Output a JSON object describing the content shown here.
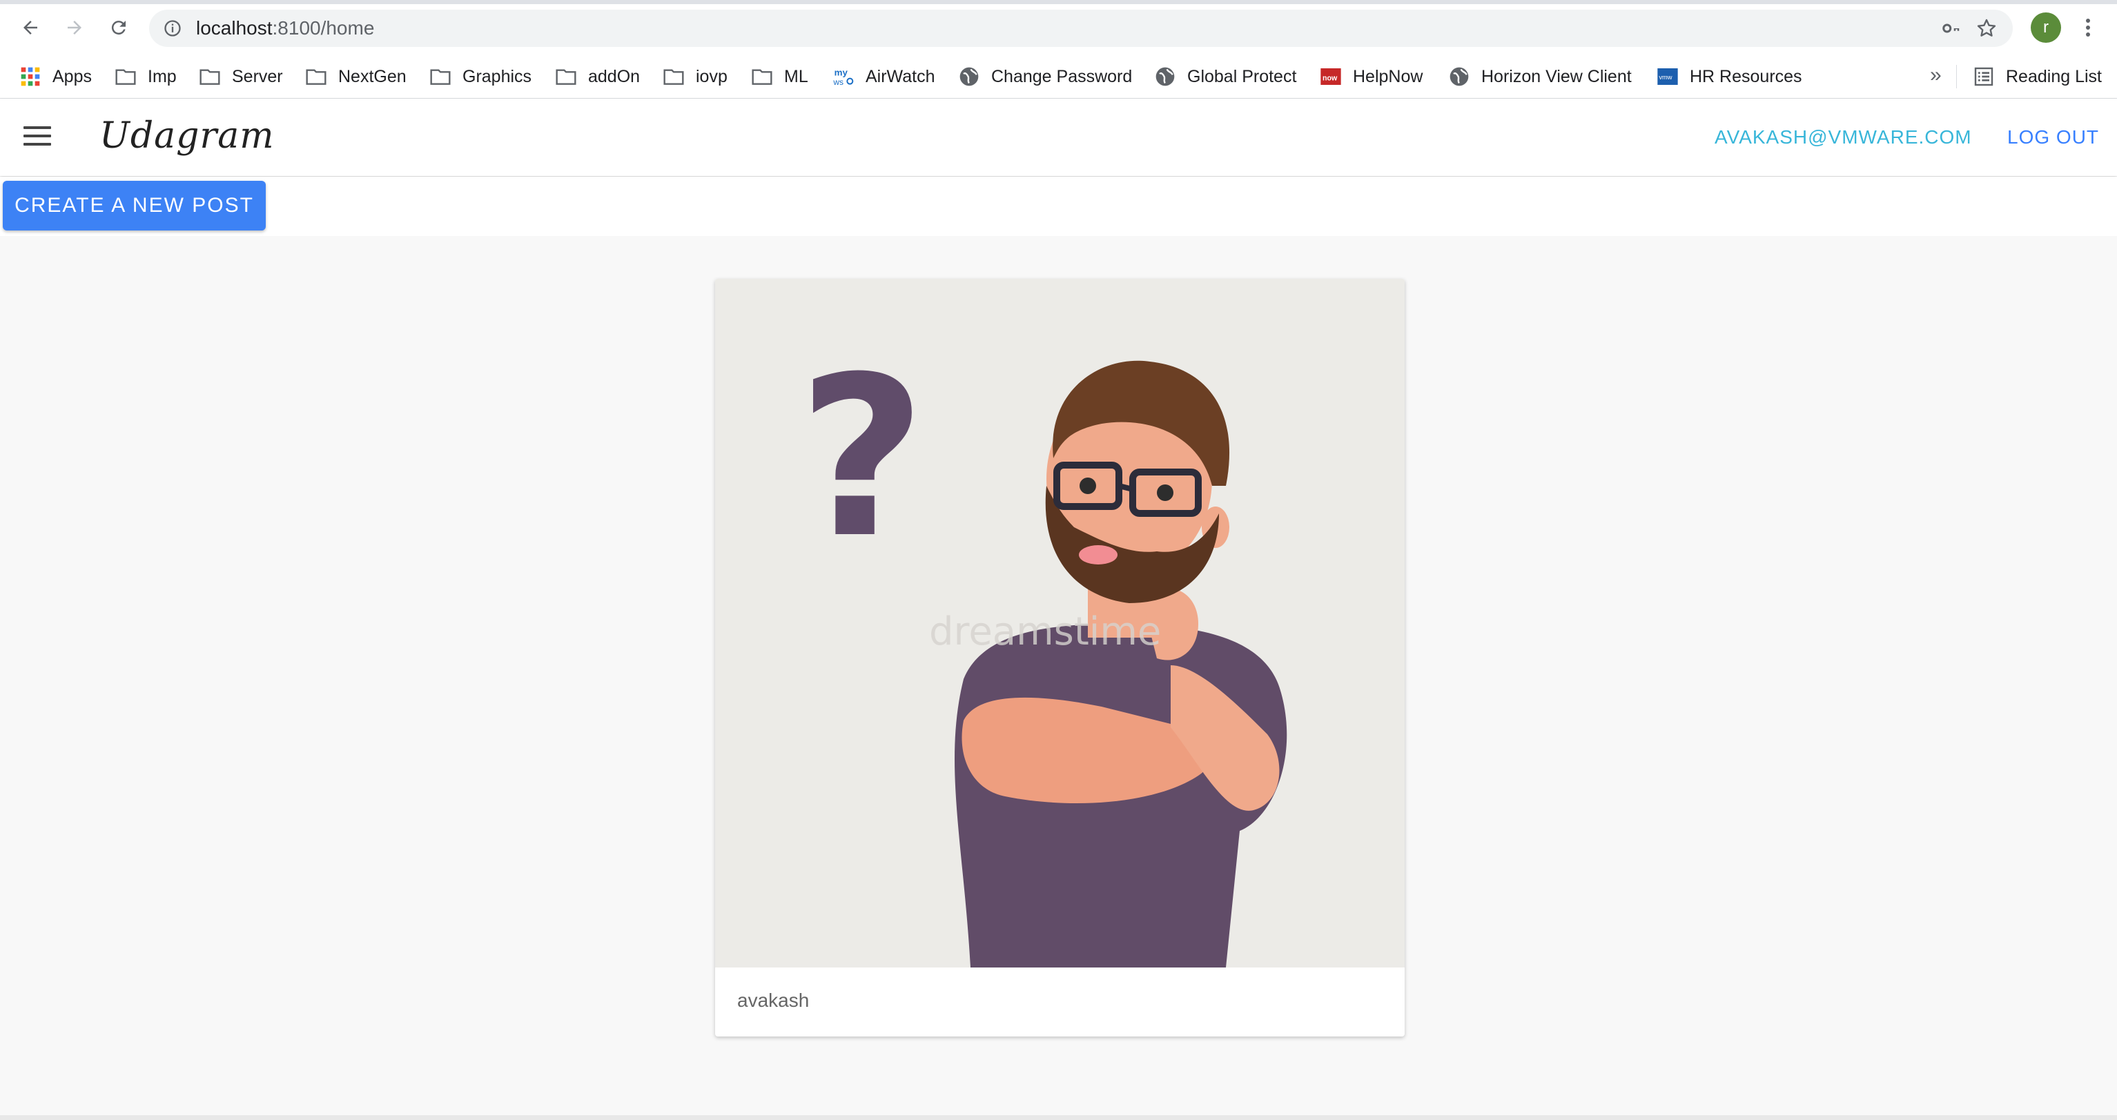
{
  "browser": {
    "url_host": "localhost",
    "url_rest": ":8100/home",
    "profile_initial": "r"
  },
  "bookmarks": {
    "items": [
      {
        "label": "Apps",
        "icon": "apps-grid-icon"
      },
      {
        "label": "Imp",
        "icon": "folder-icon"
      },
      {
        "label": "Server",
        "icon": "folder-icon"
      },
      {
        "label": "NextGen",
        "icon": "folder-icon"
      },
      {
        "label": "Graphics",
        "icon": "folder-icon"
      },
      {
        "label": "addOn",
        "icon": "folder-icon"
      },
      {
        "label": "iovp",
        "icon": "folder-icon"
      },
      {
        "label": "ML",
        "icon": "folder-icon"
      },
      {
        "label": "AirWatch",
        "icon": "my-wso-icon"
      },
      {
        "label": "Change Password",
        "icon": "globe-icon"
      },
      {
        "label": "Global Protect",
        "icon": "globe-icon"
      },
      {
        "label": "HelpNow",
        "icon": "now-icon"
      },
      {
        "label": "Horizon View Client",
        "icon": "globe-icon"
      },
      {
        "label": "HR Resources",
        "icon": "vmw-icon"
      }
    ],
    "more": "»",
    "reading_list": "Reading List"
  },
  "app": {
    "brand": "Udagram",
    "user_email": "AVAKASH@VMWARE.COM",
    "logout_label": "LOG OUT",
    "create_post_label": "CREATE A NEW POST"
  },
  "feed": {
    "items": [
      {
        "caption": "avakash",
        "image_subject": "cartoon man thinking with question mark",
        "watermark": "dreamstime"
      }
    ]
  },
  "colors": {
    "primary": "#3d82f5",
    "secondary": "#38b6d9",
    "background": "#f8f8f8"
  }
}
